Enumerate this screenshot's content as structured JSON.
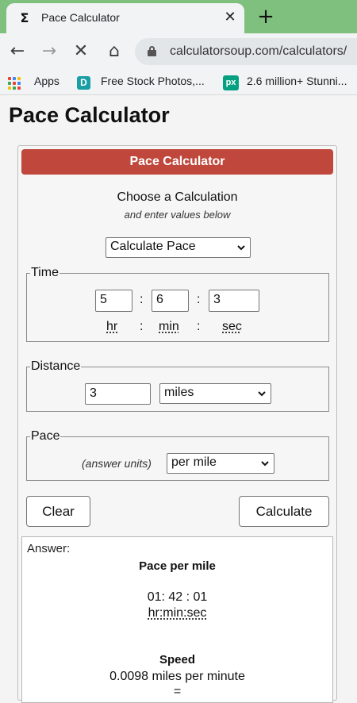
{
  "browser": {
    "tab": {
      "favicon": "Σ",
      "title": "Pace Calculator",
      "close": "✕"
    },
    "new_tab": "+",
    "nav": {
      "back": "←",
      "forward": "→",
      "stop": "✕",
      "home": "⌂"
    },
    "url": "calculatorsoup.com/calculators/",
    "bookmarks": [
      {
        "label": "Apps",
        "icon": "apps-grid-icon"
      },
      {
        "label": "Free Stock Photos,...",
        "icon": "D"
      },
      {
        "label": "2.6 million+ Stunni...",
        "icon": "px"
      }
    ]
  },
  "page": {
    "title": "Pace Calculator"
  },
  "calculator": {
    "header": "Pace Calculator",
    "choose": "Choose a Calculation",
    "enter_values": "and enter values below",
    "calculation": "Calculate Pace",
    "time": {
      "legend": "Time",
      "hours": "5",
      "minutes": "6",
      "seconds": "3",
      "sep": ":",
      "hr_label": "hr",
      "min_label": "min",
      "sec_label": "sec"
    },
    "distance": {
      "legend": "Distance",
      "value": "3",
      "unit": "miles"
    },
    "pace": {
      "legend": "Pace",
      "hint": "(answer units)",
      "unit": "per mile"
    },
    "buttons": {
      "clear": "Clear",
      "calculate": "Calculate"
    },
    "answer": {
      "label": "Answer:",
      "title": "Pace per mile",
      "value": "01: 42 : 01",
      "units": "hr:min:sec",
      "speed_title": "Speed",
      "speed_value": "0.0098 miles per minute",
      "equals": "="
    }
  },
  "colors": {
    "tab_bar": "#7fc07e",
    "header": "#c0473b",
    "chrome": "#f1f3f4"
  }
}
